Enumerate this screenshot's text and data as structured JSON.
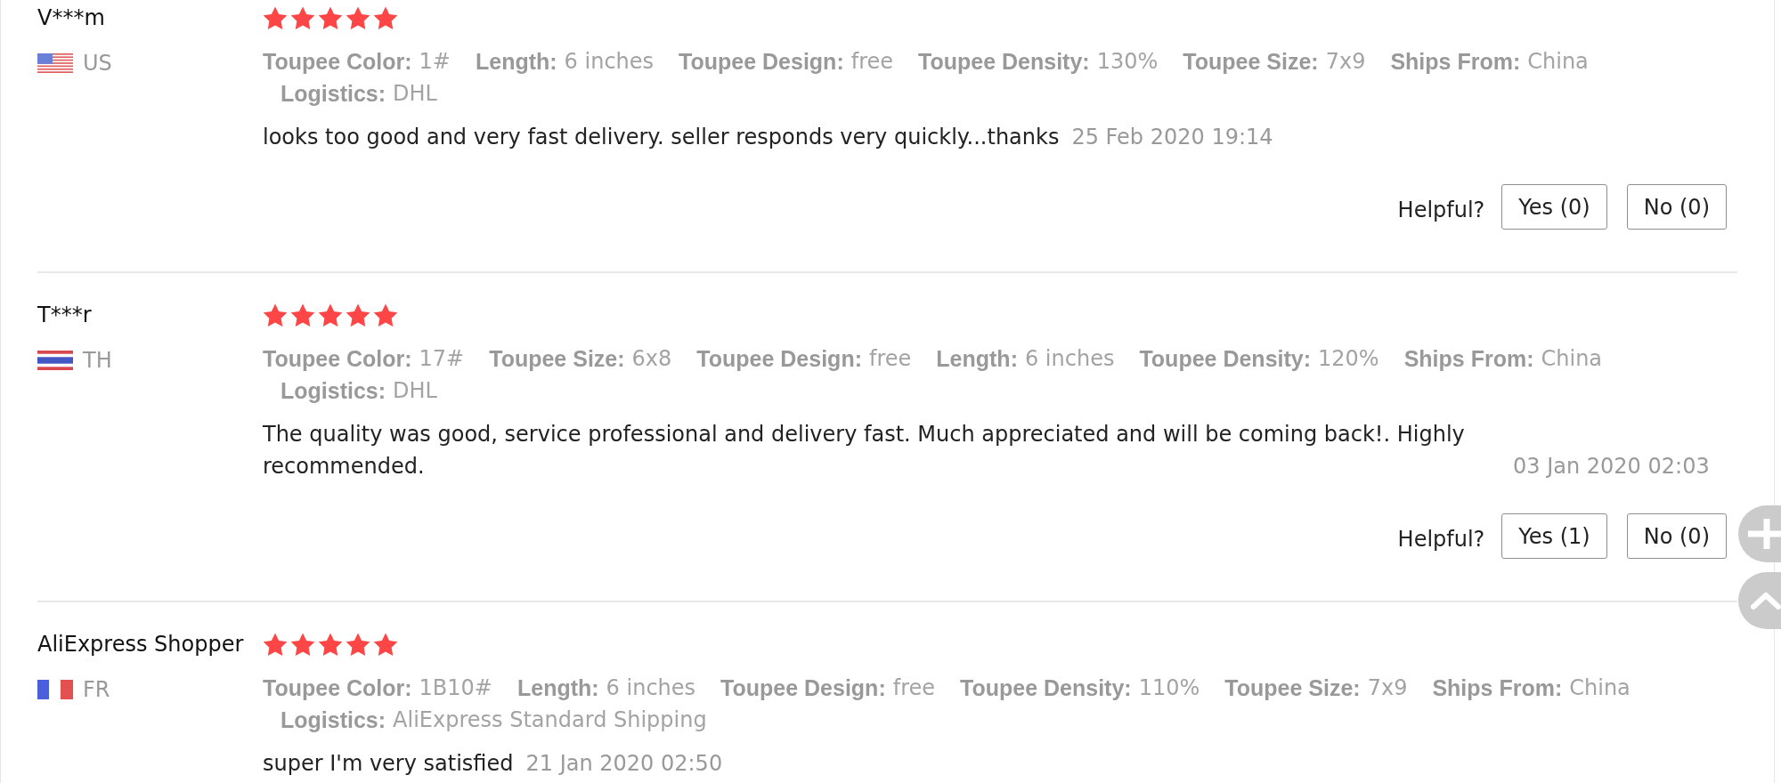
{
  "reviews": [
    {
      "name": "V***m",
      "country": "US",
      "flag": {
        "kind": "usa"
      },
      "stars": 5,
      "attributes": [
        {
          "label": "Toupee Color:",
          "value": "1#"
        },
        {
          "label": "Length:",
          "value": "6 inches"
        },
        {
          "label": "Toupee Design:",
          "value": "free"
        },
        {
          "label": "Toupee Density:",
          "value": "130%"
        },
        {
          "label": "Toupee Size:",
          "value": "7x9"
        },
        {
          "label": "Ships From:",
          "value": "China"
        },
        {
          "label": "Logistics:",
          "value": "DHL"
        }
      ],
      "comment": "looks too good and very fast delivery. seller responds very quickly...thanks",
      "date": "25 Feb 2020 19:14",
      "helpful": {
        "label": "Helpful?",
        "yes": "Yes (0)",
        "no": "No (0)"
      }
    },
    {
      "name": "T***r",
      "country": "TH",
      "flag": {
        "kind": "thailand"
      },
      "stars": 5,
      "attributes": [
        {
          "label": "Toupee Color:",
          "value": "17#"
        },
        {
          "label": "Toupee Size:",
          "value": "6x8"
        },
        {
          "label": "Toupee Design:",
          "value": "free"
        },
        {
          "label": "Length:",
          "value": "6 inches"
        },
        {
          "label": "Toupee Density:",
          "value": "120%"
        },
        {
          "label": "Ships From:",
          "value": "China"
        },
        {
          "label": "Logistics:",
          "value": "DHL"
        }
      ],
      "comment": "The quality was good, service professional and delivery fast. Much appreciated and will be coming back!. Highly recommended.",
      "date": "03 Jan 2020 02:03",
      "helpful": {
        "label": "Helpful?",
        "yes": "Yes (1)",
        "no": "No (0)"
      }
    },
    {
      "name": "AliExpress Shopper",
      "country": "FR",
      "flag": {
        "kind": "france"
      },
      "stars": 5,
      "attributes": [
        {
          "label": "Toupee Color:",
          "value": "1B10#"
        },
        {
          "label": "Length:",
          "value": "6 inches"
        },
        {
          "label": "Toupee Design:",
          "value": "free"
        },
        {
          "label": "Toupee Density:",
          "value": "110%"
        },
        {
          "label": "Toupee Size:",
          "value": "7x9"
        },
        {
          "label": "Ships From:",
          "value": "China"
        },
        {
          "label": "Logistics:",
          "value": "AliExpress Standard Shipping"
        }
      ],
      "comment": "super I'm very satisfied",
      "date": "21 Jan 2020 02:50"
    }
  ]
}
